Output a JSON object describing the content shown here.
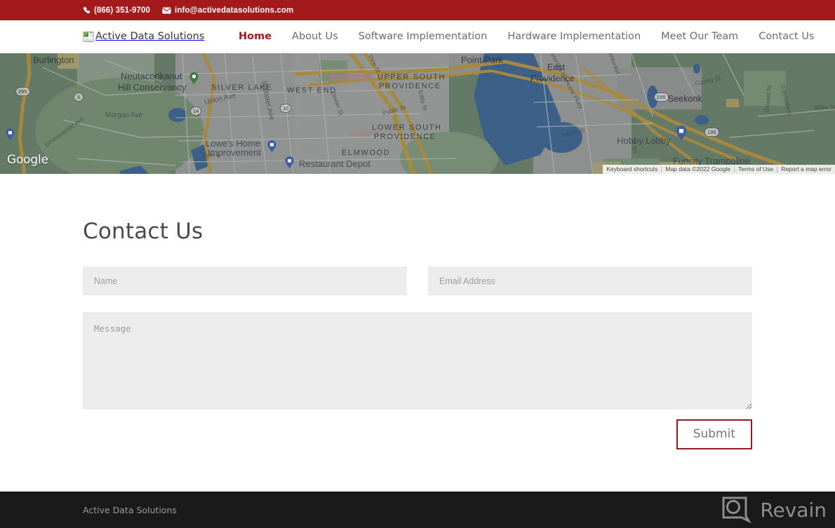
{
  "topbar": {
    "phone": "(866) 351-9700",
    "phone_icon": "phone-icon",
    "email": "info@activedatasolutions.com",
    "email_icon": "envelope-icon",
    "background_color": "#a41a1a"
  },
  "header": {
    "logo_alt": "Active Data Solutions",
    "logo_icon": "broken-image-icon",
    "nav": [
      {
        "label": "Home",
        "active": true
      },
      {
        "label": "About Us",
        "active": false
      },
      {
        "label": "Software Implementation",
        "active": false
      },
      {
        "label": "Hardware Implementation",
        "active": false
      },
      {
        "label": "Meet Our Team",
        "active": false
      },
      {
        "label": "Contact Us",
        "active": false
      }
    ],
    "accent_color": "#a41a1a"
  },
  "map": {
    "provider": "Google",
    "attribution": {
      "keyboard_shortcuts": "Keyboard shortcuts",
      "map_data": "Map data ©2022 Google",
      "terms": "Terms of Use",
      "report": "Report a map error"
    },
    "labels": {
      "burlington": "Burlington",
      "neutaconkanut": "Neutaconkanut",
      "hill_conservancy": "Hill Conservancy",
      "silver_lake": "SILVER LAKE",
      "west_end": "WEST END",
      "upper_south": "UPPER SOUTH",
      "providence_1": "PROVIDENCE",
      "lower_south": "LOWER SOUTH",
      "providence_2": "PROVIDENCE",
      "elmwood": "ELMWOOD",
      "point_park": "Point Park",
      "east": "East",
      "providence_city": "Providence",
      "seekonk": "Seekonk",
      "hobby_lobby": "Hobby Lobby",
      "funcity": "Funcity Trampoline",
      "lowes": "Lowe's Home",
      "lowes2": "Improvement",
      "restaurant_depot": "Restaurant Depot",
      "morgan_ave": "Morgan Ave",
      "union_ave": "Union Ave",
      "webster_ave": "Webster Ave",
      "simmonsville": "Simmonsville Ave",
      "dyer": "Dyer &",
      "pine_st": "Pine St",
      "dexter_st": "Dexter St",
      "public_st": "Public St",
      "eddy_st": "Eddy St",
      "veterans": "Veterans Memorial Pkwy",
      "s_broadway": "S Broadway",
      "county_st": "County St",
      "oswald_st": "Oswald St",
      "miller_st": "Miller St",
      "martin_st": "Martin St",
      "pawtucket": "Pawtucket",
      "e_sh": "E Sh",
      "route_295": "295",
      "route_5": "5",
      "route_14": "14",
      "route_10": "10",
      "route_195a": "195",
      "route_195b": "195"
    }
  },
  "contact": {
    "title": "Contact Us",
    "name_placeholder": "Name",
    "name_value": "",
    "email_placeholder": "Email Address",
    "email_value": "",
    "message_placeholder": "Message",
    "message_value": "",
    "submit_label": "Submit",
    "submit_border_color": "#8c2020"
  },
  "footer": {
    "text": "Active Data Solutions",
    "background_color": "#1a1a1a"
  },
  "watermark": {
    "text": "Revain",
    "icon": "revain-logo-icon"
  }
}
